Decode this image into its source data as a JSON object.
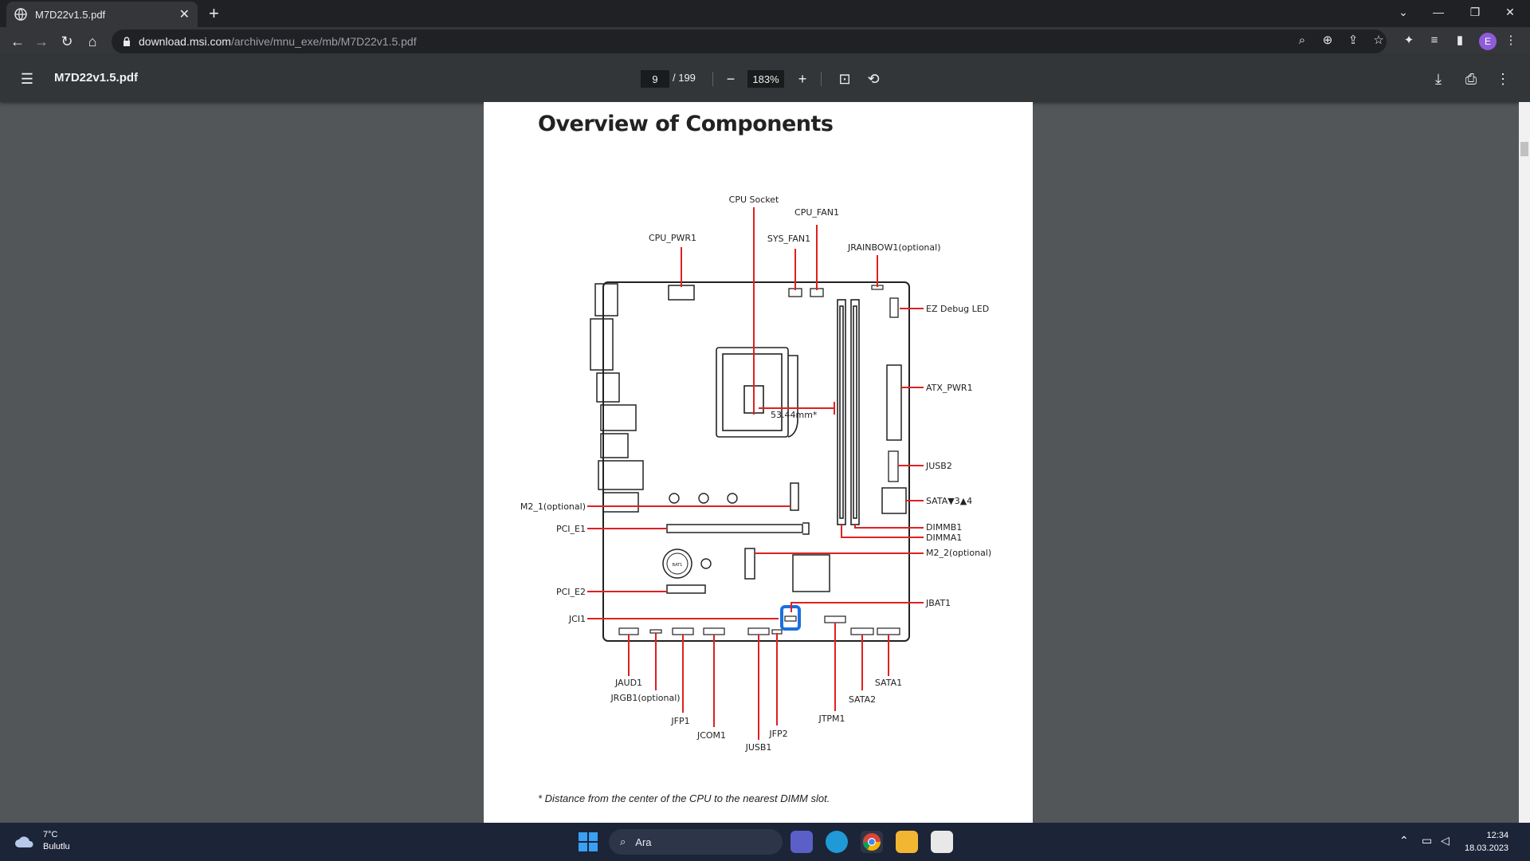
{
  "browser": {
    "tab_title": "M7D22v1.5.pdf",
    "url_host": "download.msi.com",
    "url_path": "/archive/mnu_exe/mb/M7D22v1.5.pdf",
    "profile_initial": "E",
    "accent": "#8e5cd9"
  },
  "pdf_toolbar": {
    "filename": "M7D22v1.5.pdf",
    "current_page": "9",
    "page_count": "/ 199",
    "zoom": "183%"
  },
  "document": {
    "heading": "Overview of Components",
    "footnote": "* Distance from the center of the CPU to the nearest DIMM slot.",
    "labels": {
      "cpu_socket": "CPU Socket",
      "cpu_fan1": "CPU_FAN1",
      "cpu_pwr1": "CPU_PWR1",
      "sys_fan1": "SYS_FAN1",
      "jrainbow1": "JRAINBOW1(optional)",
      "ez_debug": "EZ Debug LED",
      "atx_pwr1": "ATX_PWR1",
      "jusb2": "JUSB2",
      "sata34": "SATA▼3▲4",
      "dimmb1": "DIMMB1",
      "dimma1": "DIMMA1",
      "m2_2": "M2_2(optional)",
      "jbat1": "JBAT1",
      "m2_1": "M2_1(optional)",
      "pci_e1": "PCI_E1",
      "pci_e2": "PCI_E2",
      "jci1": "JCI1",
      "jaud1": "JAUD1",
      "jrgb1": "JRGB1(optional)",
      "jfp1": "JFP1",
      "jcom1": "JCOM1",
      "jusb1": "JUSB1",
      "jfp2": "JFP2",
      "jtpm1": "JTPM1",
      "sata2": "SATA2",
      "sata1": "SATA1",
      "distance": "53.44mm*",
      "bat1": "BAT1"
    }
  },
  "taskbar": {
    "temp": "7°C",
    "condition": "Bulutlu",
    "search_placeholder": "Ara",
    "time": "12:34",
    "date": "18.03.2023"
  }
}
